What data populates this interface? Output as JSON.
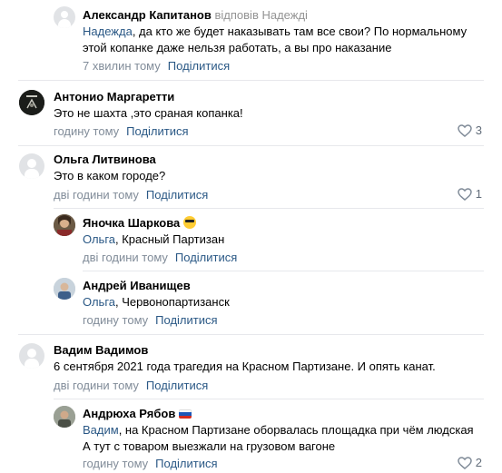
{
  "colors": {
    "link": "#2a5885",
    "meta": "#818c99",
    "divider": "#e7e8ec"
  },
  "comments": [
    {
      "author": "Александр Капитанов",
      "reply_to": "відповів Надежді",
      "mention": "Надежда",
      "text_line1": ", да кто же будет наказывать там все свои? По нормальному",
      "text_line2": "этой копанке даже нельзя работать, а вы про наказание",
      "time": "7 хвилин тому",
      "share": "Поділитися"
    },
    {
      "author": "Антонио Маргаретти",
      "text": "Это не шахта ,это сраная копанка!",
      "time": "годину тому",
      "share": "Поділитися",
      "likes": "3"
    },
    {
      "author": "Ольга Литвинова",
      "text": "Это в каком городе?",
      "time": "дві години тому",
      "share": "Поділитися",
      "likes": "1",
      "replies": [
        {
          "author": "Яночка Шаркова",
          "mention": "Ольга",
          "text": ", Красный Партизан",
          "time": "дві години тому",
          "share": "Поділитися"
        },
        {
          "author": "Андрей Иванищев",
          "mention": "Ольга",
          "text": ", Червонопартизанск",
          "time": "годину тому",
          "share": "Поділитися"
        }
      ]
    },
    {
      "author": "Вадим Вадимов",
      "text": "6 сентября 2021 года трагедия на Красном Партизане. И опять канат.",
      "time": "дві години тому",
      "share": "Поділитися",
      "replies": [
        {
          "author": "Андрюха Рябов",
          "mention": "Вадим",
          "text_line1": ", на Красном Партизане оборвалась площадка при чём людская",
          "text_line2": "А тут с товаром выезжали на грузовом вагоне",
          "time": "годину тому",
          "share": "Поділитися",
          "likes": "2"
        }
      ]
    }
  ]
}
